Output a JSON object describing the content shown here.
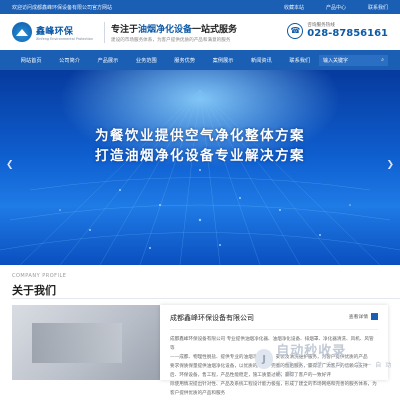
{
  "topbar": {
    "welcome": "欢迎访问成都鑫峰环保设备有限公司官方网站",
    "links": [
      "收藏本站",
      "产品中心",
      "联系我们"
    ]
  },
  "header": {
    "logo_cn": "鑫峰环保",
    "logo_en": "Xinfeng Environmental Protection",
    "slogan_pre": "专注于",
    "slogan_hl": "油烟净化设备",
    "slogan_post": "一站式服务",
    "slogan_sub": "建设的市场服务体系，为客户提供优质的产品和满意的服务",
    "hotline_label": "咨询服务热线",
    "hotline_number": "028-87856161"
  },
  "nav": {
    "items": [
      "网站首页",
      "公司简介",
      "产品展示",
      "业务范围",
      "服务优势",
      "案例展示",
      "新闻资讯",
      "联系我们"
    ],
    "search_placeholder": "输入关键字"
  },
  "hero": {
    "line1": "为餐饮业提供空气净化整体方案",
    "line2": "打造油烟净化设备专业解决方案"
  },
  "about": {
    "en": "COMPANY PROFILE",
    "title": "关于我们",
    "card_title": "成都鑫峰环保设备有限公司",
    "more": "查看详情",
    "para1": "成都鑫峰环保设备有限公司 专业提供油烟净化器、油烟净化设备、排烟罩、净化器清洗、风机、风管等",
    "para2": "——成都、物理性脱盐、提供专业的油烟净化设备，安装及清洗维护服务，为客户提供优质的产品",
    "para3": "要求保质保量提供油烟净化设备，以优质的产品，完善的售后服务，赢得了广大客户的信赖与支持",
    "para4": "后、环保设备，售工程，产品性能稳定，施工质量过硬，赢得了客户的一致好评",
    "para5": "际使用情况提出针对性、产品及系统工程设计能力极强，形成了建全的市场网络和完善的服务体系，为",
    "para6": "客户提供优质的产品和服务"
  },
  "watermark": {
    "main": "自动秒收录",
    "sub": "上 链 接 一 键 访 问 一 次 一 自 动 收 录"
  },
  "colors": {
    "brand": "#1a5fb4",
    "accent": "#0d5aa7"
  }
}
